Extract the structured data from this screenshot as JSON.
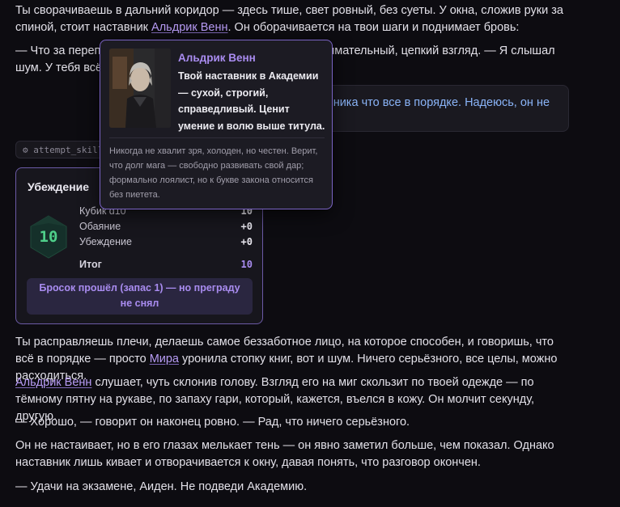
{
  "story": {
    "p1_a": "Ты сворачиваешь в дальний коридор — здесь тише, свет ровный, без суеты. У окна, сложив руки за спиной, стоит наставник ",
    "p1_link": "Альдрик Венн",
    "p1_b": ". Он оборачивается на твои шаги и поднимает бровь:",
    "p2": "— Что за переполох был у алхимиков? — в его глазах внимательный, цепкий взгляд. — Я слышал шум. У тебя всё в порядке?",
    "quote": "вника что все в порядке. Надеюсь, он не",
    "p3_a": "Ты расправляешь плечи, делаешь самое беззаботное лицо, на которое способен, и говоришь, что всё в порядке — просто ",
    "p3_link": "Мира",
    "p3_b": " уронила стопку книг, вот и шум. Ничего серьёзного, все целы, можно расходиться.",
    "p4_link": "Альдрик Венн",
    "p4_b": " слушает, чуть склонив голову. Взгляд его на миг скользит по твоей одежде — по тёмному пятну на рукаве, по запаху гари, который, кажется, въелся в кожу. Он молчит секунду, другую.",
    "p5": "— Хорошо, — говорит он наконец ровно. — Рад, что ничего серьёзного.",
    "p6": "Он не настаивает, но в его глазах мелькает тень — он явно заметил больше, чем показал. Однако наставник лишь кивает и отворачивается к окну, давая понять, что разговор окончен.",
    "p7": "— Удачи на экзамене, Аиден. Не подведи Академию."
  },
  "tool_chip": "⚙ attempt_skill",
  "skill_check": {
    "title": "Убеждение",
    "dice_value": "10",
    "rows": [
      {
        "label": "Кубик d10",
        "value": "10"
      },
      {
        "label": "Обаяние",
        "value": "+0"
      },
      {
        "label": "Убеждение",
        "value": "+0"
      }
    ],
    "total_label": "Итог",
    "total_value": "10",
    "verdict": "Бросок прошёл (запас 1) — но преграду не снял"
  },
  "tooltip": {
    "name": "Альдрик Венн",
    "short": "Твой наставник в Академии — сухой, строгий, справедливый. Ценит умение и волю выше титула.",
    "desc": "Никогда не хвалит зря, холоден, но честен. Верит, что долг мага — свободно развивать свой дар; формально лоялист, но к букве закона относится без пиетета."
  },
  "colors": {
    "background": "#0d0c11",
    "accent": "#a98cf0",
    "link": "#b89cf5",
    "quote_text": "#8ab4f8",
    "dice_green": "#4fd08a"
  }
}
